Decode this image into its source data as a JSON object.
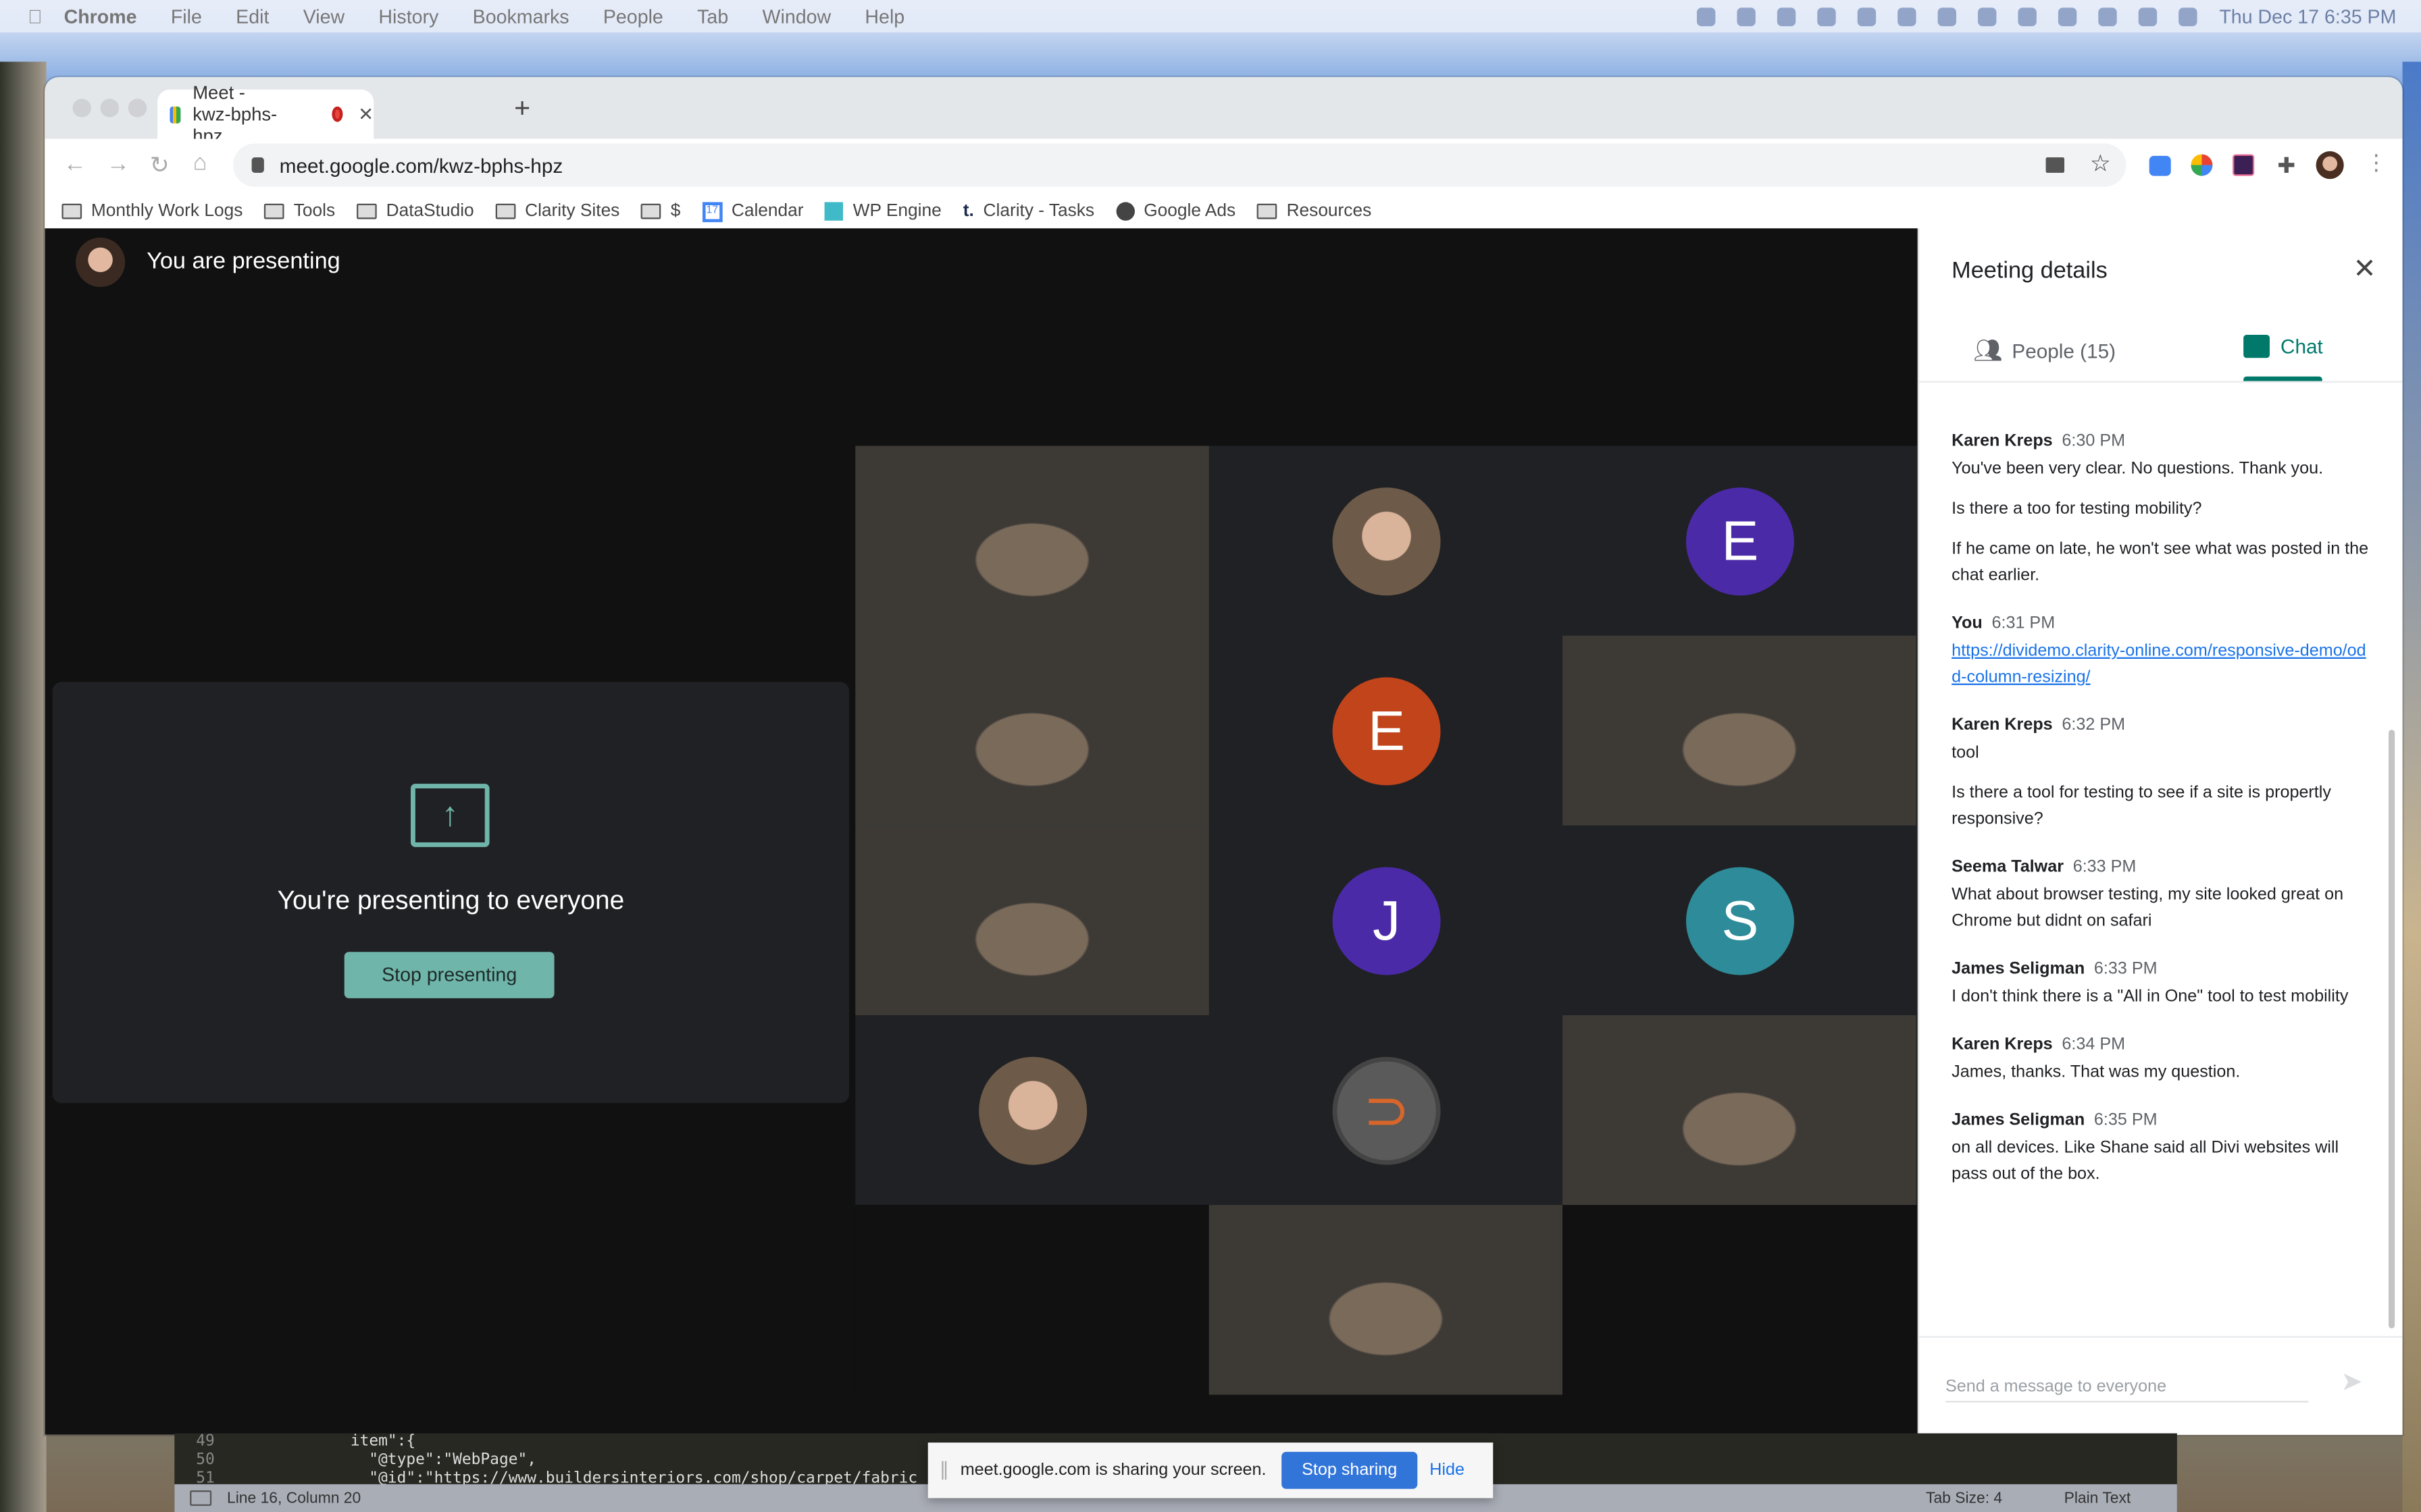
{
  "menubar": {
    "app": "Chrome",
    "items": [
      "File",
      "Edit",
      "View",
      "History",
      "Bookmarks",
      "People",
      "Tab",
      "Window",
      "Help"
    ],
    "clock": "Thu Dec 17  6:35 PM"
  },
  "browser": {
    "tab_title": "Meet - kwz-bphs-hpz",
    "url": "meet.google.com/kwz-bphs-hpz",
    "bookmarks": [
      {
        "label": "Monthly Work Logs",
        "icon": "folder"
      },
      {
        "label": "Tools",
        "icon": "folder"
      },
      {
        "label": "DataStudio",
        "icon": "folder"
      },
      {
        "label": "Clarity Sites",
        "icon": "folder"
      },
      {
        "label": "$",
        "icon": "folder"
      },
      {
        "label": "Calendar",
        "icon": "calendar"
      },
      {
        "label": "WP Engine",
        "icon": "wpengine"
      },
      {
        "label": "Clarity - Tasks",
        "icon": "t-logo"
      },
      {
        "label": "Google Ads",
        "icon": "globe"
      },
      {
        "label": "Resources",
        "icon": "folder"
      }
    ]
  },
  "meet": {
    "header": "You are presenting",
    "card_title": "You're presenting to everyone",
    "stop_presenting": "Stop presenting",
    "tiles": [
      {
        "type": "video"
      },
      {
        "type": "photo"
      },
      {
        "type": "letter",
        "letter": "E",
        "color": "#4b2aa8"
      },
      {
        "type": "video"
      },
      {
        "type": "letter",
        "letter": "E",
        "color": "#c1441b"
      },
      {
        "type": "video"
      },
      {
        "type": "video"
      },
      {
        "type": "letter",
        "letter": "J",
        "color": "#4b2aa8"
      },
      {
        "type": "letter",
        "letter": "S",
        "color": "#2e8b99"
      },
      {
        "type": "photo"
      },
      {
        "type": "logo"
      },
      {
        "type": "video"
      },
      {
        "type": "empty"
      },
      {
        "type": "video"
      },
      {
        "type": "empty"
      }
    ]
  },
  "panel": {
    "title": "Meeting details",
    "tab_people": "People (15)",
    "tab_chat": "Chat",
    "accent": "#00796b",
    "messages": [
      {
        "sender": "Karen Kreps",
        "time": "6:30 PM",
        "lines": [
          "You've been very clear. No questions. Thank you.",
          "Is there a too for testing mobility?",
          "If he came on late, he won't see what was posted in the chat earlier."
        ]
      },
      {
        "sender": "You",
        "time": "6:31 PM",
        "link": "https://dividemo.clarity-online.com/responsive-demo/odd-column-resizing/"
      },
      {
        "sender": "Karen Kreps",
        "time": "6:32 PM",
        "lines": [
          "tool",
          "Is there a tool for testing to see if a site is propertly responsive?"
        ]
      },
      {
        "sender": "Seema Talwar",
        "time": "6:33 PM",
        "lines": [
          "What about browser testing, my site looked great on Chrome but didnt on safari"
        ]
      },
      {
        "sender": "James Seligman",
        "time": "6:33 PM",
        "lines": [
          "I don't think there is a \"All in One\" tool to test mobility"
        ]
      },
      {
        "sender": "Karen Kreps",
        "time": "6:34 PM",
        "lines": [
          "James, thanks. That was my question."
        ]
      },
      {
        "sender": "James Seligman",
        "time": "6:35 PM",
        "lines": [
          "on all devices. Like Shane said all Divi websites will pass out of the box."
        ]
      }
    ],
    "input_placeholder": "Send a message to everyone"
  },
  "editor": {
    "lines": [
      {
        "n": "49",
        "code": "item\":{"
      },
      {
        "n": "50",
        "code": "\"@type\":\"WebPage\","
      },
      {
        "n": "51",
        "code": "\"@id\":\"https://www.buildersinteriors.com/shop/carpet/fabric"
      }
    ],
    "status_left": "Line 16, Column 20",
    "tab_size": "Tab Size: 4",
    "syntax": "Plain Text"
  },
  "sharebar": {
    "text": "meet.google.com is sharing your screen.",
    "stop": "Stop sharing",
    "hide": "Hide"
  }
}
